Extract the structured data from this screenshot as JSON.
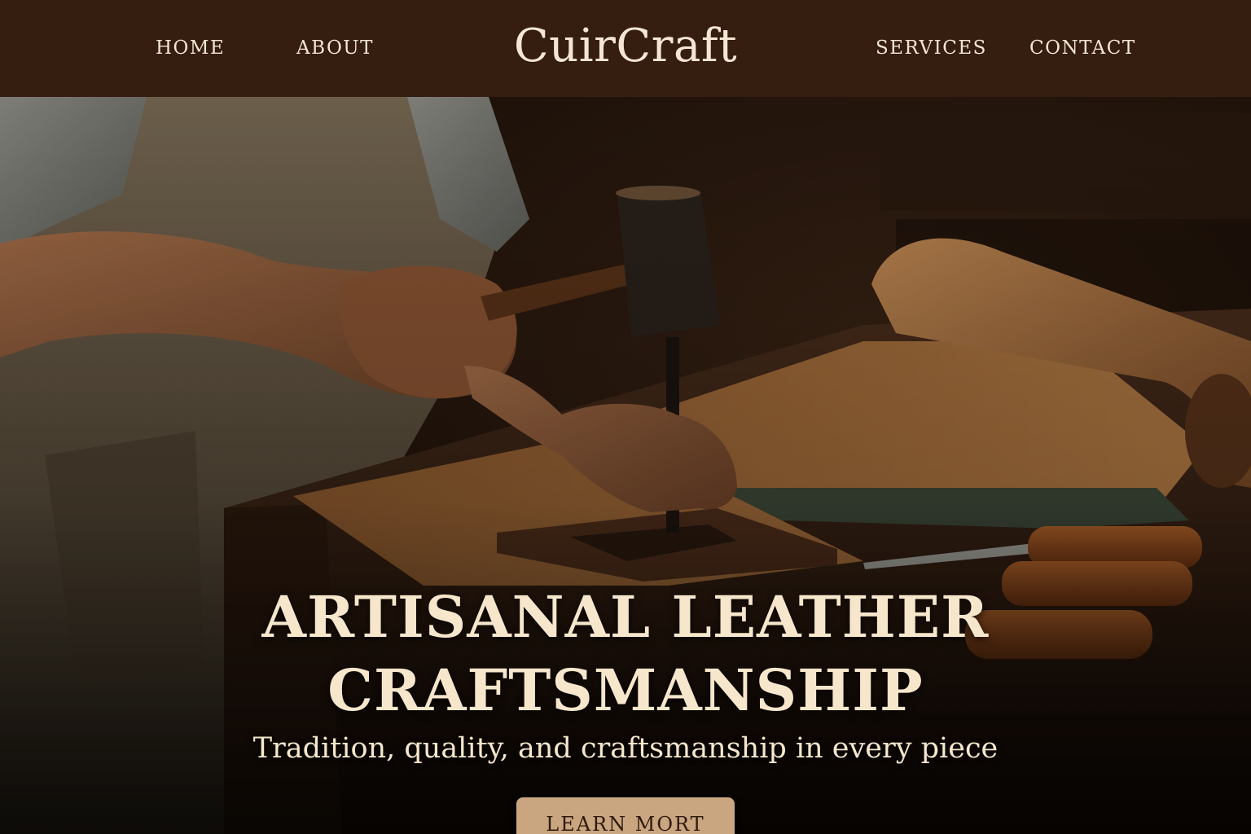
{
  "nav": {
    "brand": "CuirCraft",
    "items": [
      {
        "label": "HOME"
      },
      {
        "label": "ABOUT"
      },
      {
        "label": "SERVICES"
      },
      {
        "label": "CONTACT"
      }
    ]
  },
  "hero": {
    "headline_line1": "ARTISANAL LEATHER",
    "headline_line2": "CRAFTSMANSHIP",
    "subtitle": "Tradition, quality, and craftsmanship in every piece",
    "cta_label": "LEARN MORT",
    "image_description_icon": "leatherworker-stamping-photo"
  },
  "colors": {
    "nav_background": "#351d0f",
    "nav_text": "#f4e6d2",
    "headline_text": "#f6e7cc",
    "cta_background": "#c9a580",
    "cta_text": "#2e1a0d"
  }
}
